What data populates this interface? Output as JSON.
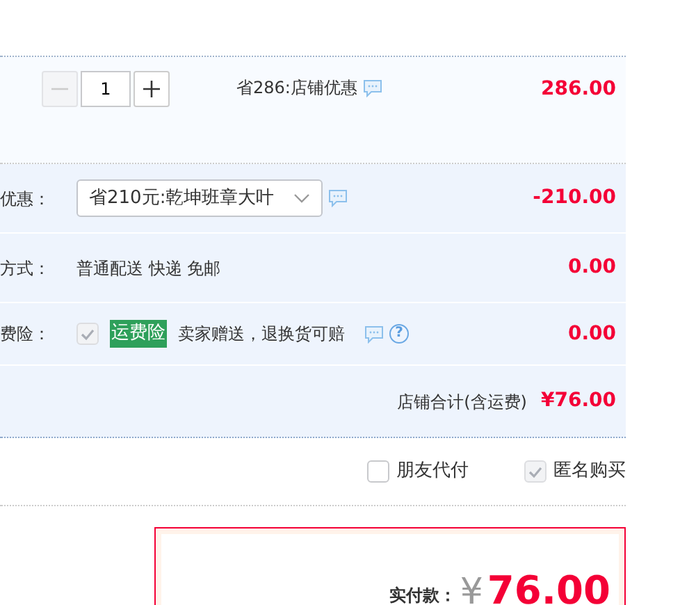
{
  "item": {
    "quantity": "1",
    "minus_disabled": true,
    "promo": "省286:店铺优惠",
    "price": "286.00"
  },
  "rows": [
    {
      "kind": "select",
      "label": "优惠：",
      "value": "省210元:乾坤班章大叶",
      "amount": "-210.00"
    },
    {
      "kind": "text",
      "label": "方式：",
      "value": "普通配送 快递 免邮",
      "amount": "0.00"
    },
    {
      "kind": "insurance",
      "label": "费险：",
      "checked": true,
      "disabled": true,
      "tag": "运费险",
      "value": "卖家赠送，退换货可赔",
      "help": "?",
      "amount": "0.00"
    }
  ],
  "total": {
    "label": "店铺合计(含运费)",
    "amount": "¥76.00"
  },
  "options": [
    {
      "label": "朋友代付",
      "checked": false,
      "disabled": false
    },
    {
      "label": "匿名购买",
      "checked": true,
      "disabled": true
    }
  ],
  "payment": {
    "label": "实付款：",
    "currency": "¥",
    "amount": "76.00"
  }
}
